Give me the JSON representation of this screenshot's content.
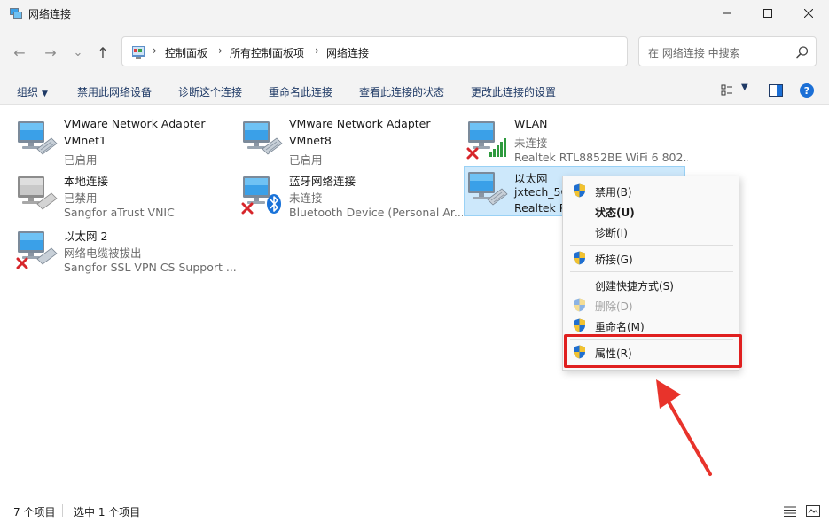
{
  "window": {
    "title": "网络连接",
    "controls": {
      "minimize": "—",
      "maximize": "☐",
      "close": "✕"
    }
  },
  "nav": {
    "back": "←",
    "forward": "→",
    "recent": "⌄",
    "up": "↑",
    "breadcrumb": [
      "控制面板",
      "所有控制面板项",
      "网络连接"
    ],
    "search_placeholder": "在 网络连接 中搜索"
  },
  "toolbar": {
    "organize": "组织",
    "items": [
      "禁用此网络设备",
      "诊断这个连接",
      "重命名此连接",
      "查看此连接的状态",
      "更改此连接的设置"
    ]
  },
  "connections": [
    {
      "name": "VMware Network Adapter",
      "line2": "VMnet1",
      "line3": "已启用",
      "status": "enabled"
    },
    {
      "name": "VMware Network Adapter",
      "line2": "VMnet8",
      "line3": "已启用",
      "status": "enabled"
    },
    {
      "name": "WLAN",
      "line2": "未连接",
      "line3": "Realtek RTL8852BE WiFi 6 802....",
      "status": "wifi-disconnected"
    },
    {
      "name": "本地连接",
      "line2": "已禁用",
      "line3": "Sangfor aTrust VNIC",
      "status": "disabled"
    },
    {
      "name": "蓝牙网络连接",
      "line2": "未连接",
      "line3": "Bluetooth Device (Personal Ar...",
      "status": "bluetooth-disconnected"
    },
    {
      "name": "以太网",
      "line2": "jxtech_5G",
      "line3": "Realtek P",
      "status": "selected"
    },
    {
      "name": "以太网 2",
      "line2": "网络电缆被拔出",
      "line3": "Sangfor SSL VPN CS Support ...",
      "status": "unplugged"
    }
  ],
  "context_menu": {
    "items": [
      {
        "label": "禁用(B)",
        "shield": true,
        "bold": false,
        "disabled": false
      },
      {
        "label": "状态(U)",
        "shield": false,
        "bold": true,
        "disabled": false
      },
      {
        "label": "诊断(I)",
        "shield": false,
        "bold": false,
        "disabled": false
      },
      {
        "label": "桥接(G)",
        "shield": true,
        "bold": false,
        "disabled": false
      },
      {
        "label": "创建快捷方式(S)",
        "shield": false,
        "bold": false,
        "disabled": false
      },
      {
        "label": "删除(D)",
        "shield": true,
        "bold": false,
        "disabled": true
      },
      {
        "label": "重命名(M)",
        "shield": true,
        "bold": false,
        "disabled": false
      },
      {
        "label": "属性(R)",
        "shield": true,
        "bold": false,
        "disabled": false
      }
    ]
  },
  "status": {
    "count": "7 个项目",
    "selected": "选中 1 个项目"
  },
  "colors": {
    "accent": "#1b6fd6",
    "highlight": "#e02020",
    "selection": "#cde8fb"
  }
}
